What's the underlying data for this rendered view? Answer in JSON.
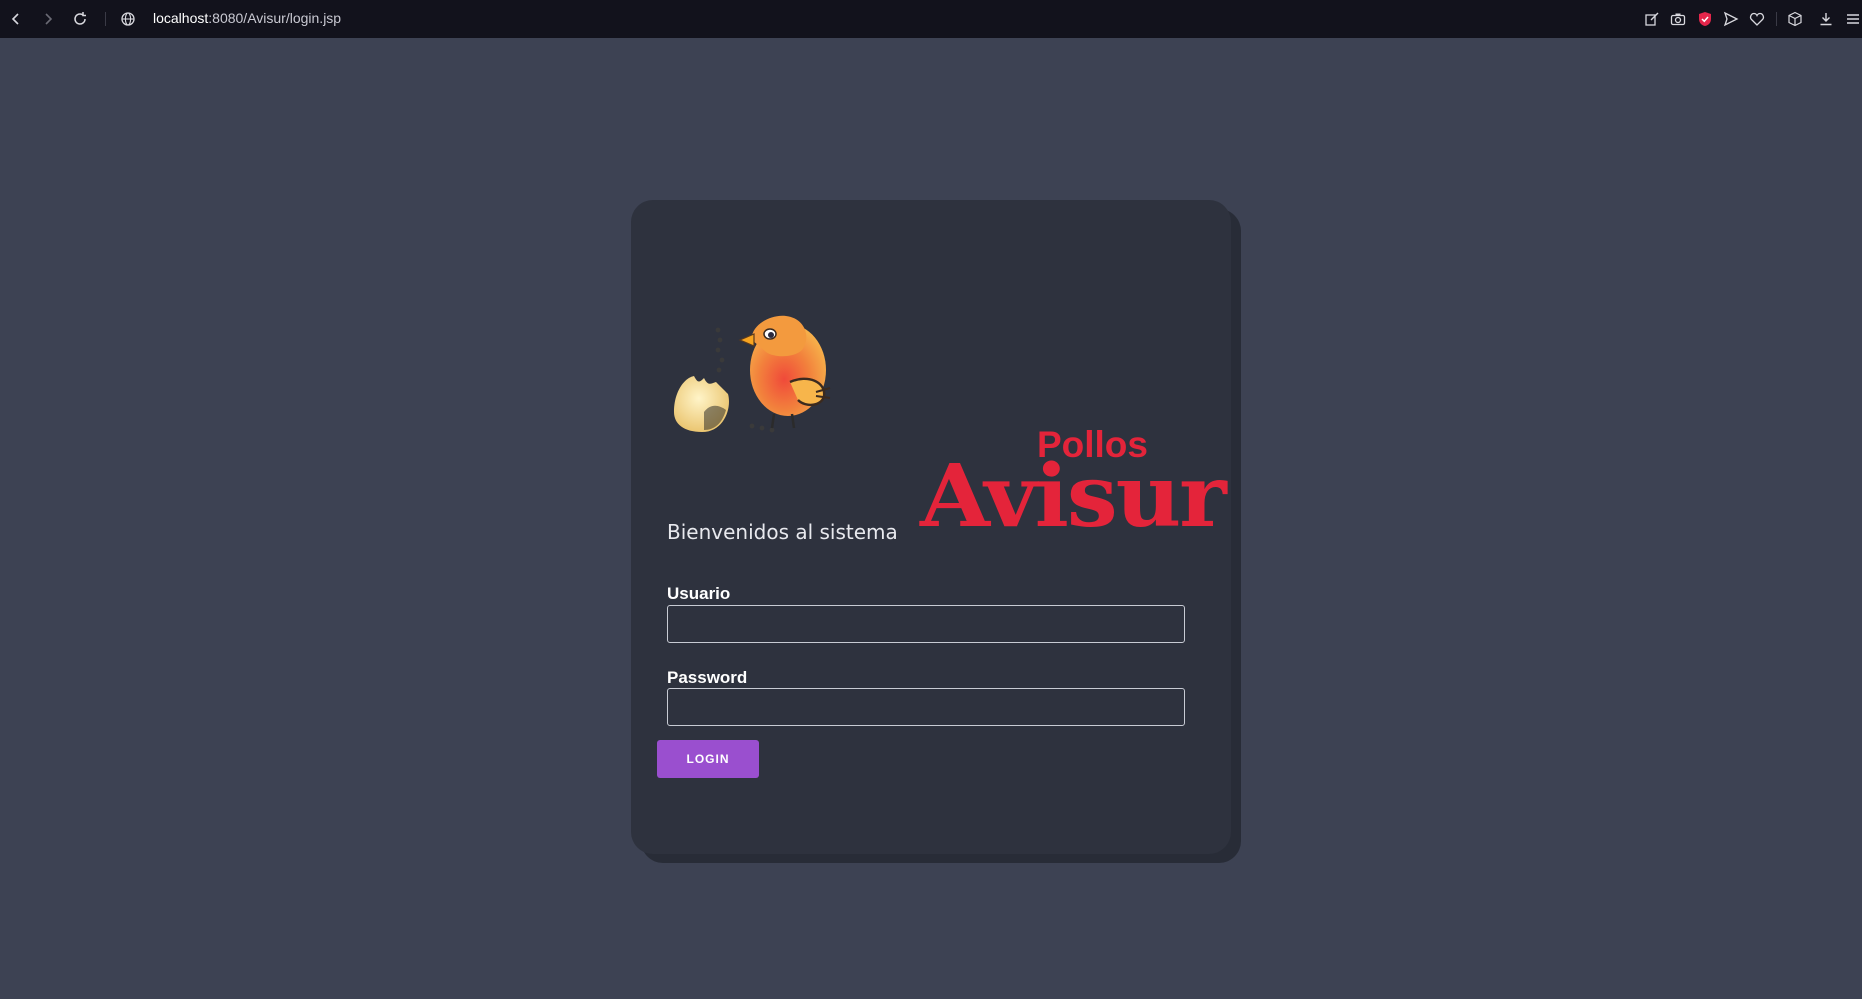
{
  "browser": {
    "url_host": "localhost",
    "url_rest": ":8080/Avisur/login.jsp",
    "icons": [
      "back-icon",
      "forward-icon",
      "reload-icon",
      "globe-icon",
      "edit-icon",
      "camera-icon",
      "shield-icon",
      "send-icon",
      "heart-icon",
      "box-icon",
      "download-icon",
      "menu-icon"
    ]
  },
  "logo": {
    "line1": "Pollos",
    "line2": "Avisur",
    "brand_color": "#e4243a"
  },
  "login": {
    "welcome": "Bienvenidos al sistema",
    "user_label": "Usuario",
    "user_value": "",
    "password_label": "Password",
    "password_value": "",
    "button_label": "LOGIN",
    "button_color": "#9a4fcf"
  }
}
